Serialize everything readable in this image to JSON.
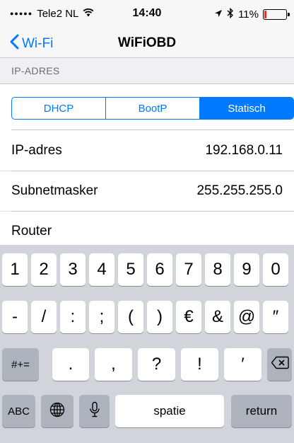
{
  "status_bar": {
    "signal": "●●●●●",
    "carrier": "Tele2 NL",
    "wifi_icon": "wifi-icon",
    "time": "14:40",
    "location_icon": "location-arrow-icon",
    "bluetooth_icon": "bluetooth-icon",
    "battery_percent": "11%",
    "battery_level": 0.11,
    "battery_color": "#e0312d"
  },
  "nav": {
    "back_label": "Wi-Fi",
    "title": "WiFiOBD"
  },
  "section": {
    "header": "IP-ADRES"
  },
  "segmented": {
    "options": [
      "DHCP",
      "BootP",
      "Statisch"
    ],
    "selected": "Statisch"
  },
  "rows": [
    {
      "label": "IP-adres",
      "value": "192.168.0.11"
    },
    {
      "label": "Subnetmasker",
      "value": "255.255.255.0"
    },
    {
      "label": "Router",
      "value": ""
    }
  ],
  "keyboard": {
    "row1": [
      "1",
      "2",
      "3",
      "4",
      "5",
      "6",
      "7",
      "8",
      "9",
      "0"
    ],
    "row2": [
      "-",
      "/",
      ":",
      ";",
      "(",
      ")",
      "€",
      "&",
      "@",
      "″"
    ],
    "row3_left": "#+=",
    "row3": [
      ".",
      ",",
      "?",
      "!",
      "′"
    ],
    "delete_icon": "backspace-icon",
    "abc": "ABC",
    "globe_icon": "globe-icon",
    "mic_icon": "microphone-icon",
    "space": "spatie",
    "return": "return"
  },
  "colors": {
    "accent": "#007aff",
    "keyboard_bg": "#d1d5db",
    "function_key": "#adb3bc"
  }
}
